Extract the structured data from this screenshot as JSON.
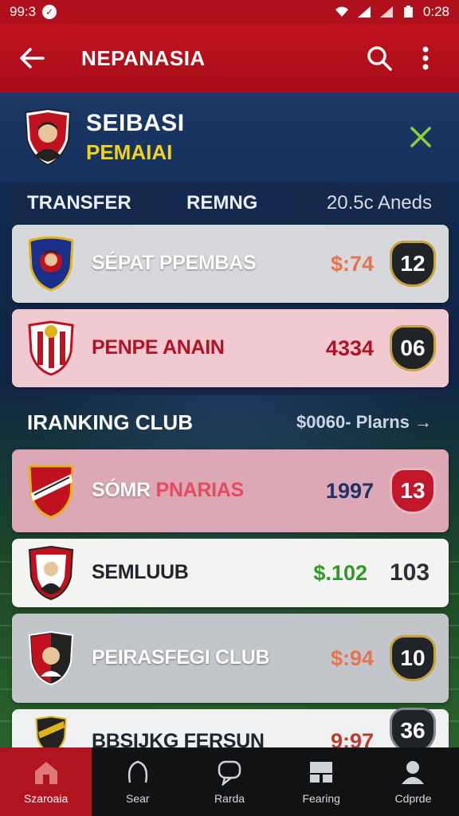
{
  "status_bar": {
    "time_left": "99:3",
    "time_right": "0:28"
  },
  "app_bar": {
    "title": "NEPANASIA"
  },
  "profile": {
    "name": "SEIBASI",
    "subtitle": "PEMAIAI"
  },
  "transfer": {
    "col1": "TRANSFER",
    "col2": "REMNG",
    "col3": "20.5c Aneds",
    "items": [
      {
        "name": "SÉPAT PPEMBAS",
        "price": "$:74",
        "badge": "12",
        "price_color": "#e8734f",
        "card_bg": "#d6d8dc",
        "name_color": "#ffffff"
      },
      {
        "name": "PENPE ANAIN",
        "price": "4334",
        "badge": "06",
        "price_color": "#b31124",
        "card_bg": "#f1c9d1",
        "name_color": "#b31124"
      }
    ]
  },
  "ranking": {
    "title": "IRANKING CLUB",
    "link": "$0060- Plarns →",
    "items": [
      {
        "name_a": "SÓMR ",
        "name_b": "PNARIAS",
        "price": "1997",
        "badge": "13",
        "price_color": "#20326b",
        "card_bg": "#dca8b5"
      },
      {
        "name": "SEMLUUB",
        "price": "$.102",
        "badge": "103",
        "price_color": "#2f9a28",
        "card_bg": "#f3f4f1"
      },
      {
        "name": "PEIRASFEGI CLUB",
        "price": "$:94",
        "badge": "10",
        "price_color": "#e8734f",
        "card_bg": "#c2c5ca"
      },
      {
        "name": "BBSIJKG FERSUN",
        "price": "9:97",
        "badge": "36",
        "price_color": "#c0392b",
        "card_bg": "#eef0f2"
      }
    ]
  },
  "bottom_nav": [
    {
      "label": "Szaroaia",
      "icon": "home-icon"
    },
    {
      "label": "Sear",
      "icon": "search-icon"
    },
    {
      "label": "Rarda",
      "icon": "chat-icon"
    },
    {
      "label": "Fearing",
      "icon": "cards-icon"
    },
    {
      "label": "Cdprde",
      "icon": "profile-icon"
    }
  ],
  "colors": {
    "primary_red": "#b0101c",
    "navy": "#15315d",
    "yellow": "#f2d21a",
    "green_check": "#8bd13a"
  }
}
